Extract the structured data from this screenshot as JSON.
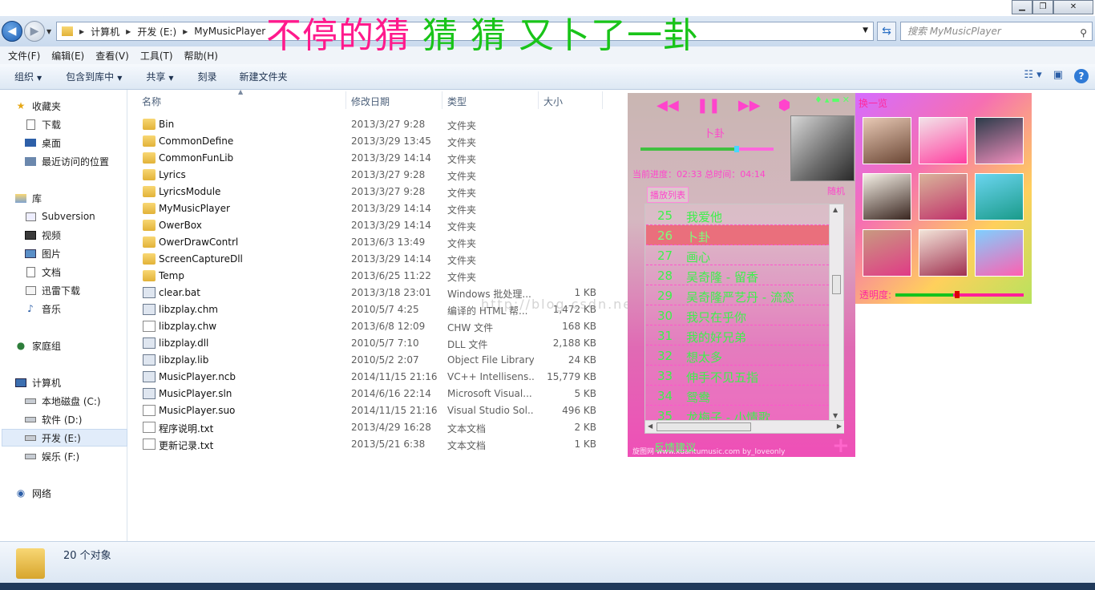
{
  "banner": {
    "part1": "不停的猜",
    "part2": "猜 猜 又卜了一卦"
  },
  "address": {
    "segments": [
      "计算机",
      "开发 (E:)",
      "MyMusicPlayer"
    ],
    "search_placeholder": "搜索 MyMusicPlayer"
  },
  "menu": [
    "文件(F)",
    "编辑(E)",
    "查看(V)",
    "工具(T)",
    "帮助(H)"
  ],
  "toolbar": {
    "organize": "组织",
    "include_in_library": "包含到库中",
    "share": "共享",
    "burn": "刻录",
    "new_folder": "新建文件夹"
  },
  "nav": {
    "favorites": "收藏夹",
    "fav_items": [
      "下载",
      "桌面",
      "最近访问的位置"
    ],
    "libraries": "库",
    "lib_items": [
      "Subversion",
      "视频",
      "图片",
      "文档",
      "迅雷下载",
      "音乐"
    ],
    "homegroup": "家庭组",
    "computer": "计算机",
    "drives": [
      "本地磁盘 (C:)",
      "软件 (D:)",
      "开发 (E:)",
      "娱乐 (F:)"
    ],
    "network": "网络"
  },
  "columns": {
    "name": "名称",
    "date": "修改日期",
    "type": "类型",
    "size": "大小"
  },
  "files": [
    {
      "name": "Bin",
      "date": "2013/3/27 9:28",
      "type": "文件夹",
      "size": "",
      "icon": "folder"
    },
    {
      "name": "CommonDefine",
      "date": "2013/3/29 13:45",
      "type": "文件夹",
      "size": "",
      "icon": "folder"
    },
    {
      "name": "CommonFunLib",
      "date": "2013/3/29 14:14",
      "type": "文件夹",
      "size": "",
      "icon": "folder"
    },
    {
      "name": "Lyrics",
      "date": "2013/3/27 9:28",
      "type": "文件夹",
      "size": "",
      "icon": "folder"
    },
    {
      "name": "LyricsModule",
      "date": "2013/3/27 9:28",
      "type": "文件夹",
      "size": "",
      "icon": "folder"
    },
    {
      "name": "MyMusicPlayer",
      "date": "2013/3/29 14:14",
      "type": "文件夹",
      "size": "",
      "icon": "folder"
    },
    {
      "name": "OwerBox",
      "date": "2013/3/29 14:14",
      "type": "文件夹",
      "size": "",
      "icon": "folder"
    },
    {
      "name": "OwerDrawContrl",
      "date": "2013/6/3 13:49",
      "type": "文件夹",
      "size": "",
      "icon": "folder"
    },
    {
      "name": "ScreenCaptureDll",
      "date": "2013/3/29 14:14",
      "type": "文件夹",
      "size": "",
      "icon": "folder"
    },
    {
      "name": "Temp",
      "date": "2013/6/25 11:22",
      "type": "文件夹",
      "size": "",
      "icon": "folder"
    },
    {
      "name": "clear.bat",
      "date": "2013/3/18 23:01",
      "type": "Windows 批处理...",
      "size": "1 KB",
      "icon": "bat"
    },
    {
      "name": "libzplay.chm",
      "date": "2010/5/7 4:25",
      "type": "编译的 HTML 帮...",
      "size": "1,472 KB",
      "icon": "chm"
    },
    {
      "name": "libzplay.chw",
      "date": "2013/6/8 12:09",
      "type": "CHW 文件",
      "size": "168 KB",
      "icon": "doc"
    },
    {
      "name": "libzplay.dll",
      "date": "2010/5/7 7:10",
      "type": "DLL 文件",
      "size": "2,188 KB",
      "icon": "dll"
    },
    {
      "name": "libzplay.lib",
      "date": "2010/5/2 2:07",
      "type": "Object File Library",
      "size": "24 KB",
      "icon": "lib"
    },
    {
      "name": "MusicPlayer.ncb",
      "date": "2014/11/15 21:16",
      "type": "VC++ Intellisens...",
      "size": "15,779 KB",
      "icon": "ncb"
    },
    {
      "name": "MusicPlayer.sln",
      "date": "2014/6/16 22:14",
      "type": "Microsoft Visual...",
      "size": "5 KB",
      "icon": "sln"
    },
    {
      "name": "MusicPlayer.suo",
      "date": "2014/11/15 21:16",
      "type": "Visual Studio Sol...",
      "size": "496 KB",
      "icon": "doc"
    },
    {
      "name": "程序说明.txt",
      "date": "2013/4/29 16:28",
      "type": "文本文档",
      "size": "2 KB",
      "icon": "txt"
    },
    {
      "name": "更新记录.txt",
      "date": "2013/5/21 6:38",
      "type": "文本文档",
      "size": "1 KB",
      "icon": "txt"
    }
  ],
  "watermark": "http://blog.csdn.net/mfc",
  "status": {
    "count": "20 个对象"
  },
  "player": {
    "song": "卜卦",
    "time": "当前进度：02:33    总时间：04:14",
    "progress": 0.72,
    "shuffle": "随机",
    "playlist_tab": "播放列表",
    "playlist": [
      {
        "n": "25",
        "t": "我爱他"
      },
      {
        "n": "26",
        "t": "卜卦"
      },
      {
        "n": "27",
        "t": "画心"
      },
      {
        "n": "28",
        "t": "吴奇隆 - 留香"
      },
      {
        "n": "29",
        "t": "吴奇隆严艺丹 - 流恋"
      },
      {
        "n": "30",
        "t": "我只在乎你"
      },
      {
        "n": "31",
        "t": "我的好兄弟"
      },
      {
        "n": "32",
        "t": "想太多"
      },
      {
        "n": "33",
        "t": "伸手不见五指"
      },
      {
        "n": "34",
        "t": "鸳鸯"
      },
      {
        "n": "35",
        "t": "龙梅子 - 小情歌"
      }
    ],
    "selected_index": 1,
    "feedback": "反馈建议",
    "credit": "旋图网 www.xuantumusic.com      by_loveonly"
  },
  "skin": {
    "title": "换一览",
    "alpha_label": "透明度:",
    "alpha": 0.45
  },
  "colors": {
    "pink": "#ff44cc",
    "green": "#3ef04c",
    "banner_pink": "#ff1a8c",
    "banner_green": "#19c419"
  }
}
